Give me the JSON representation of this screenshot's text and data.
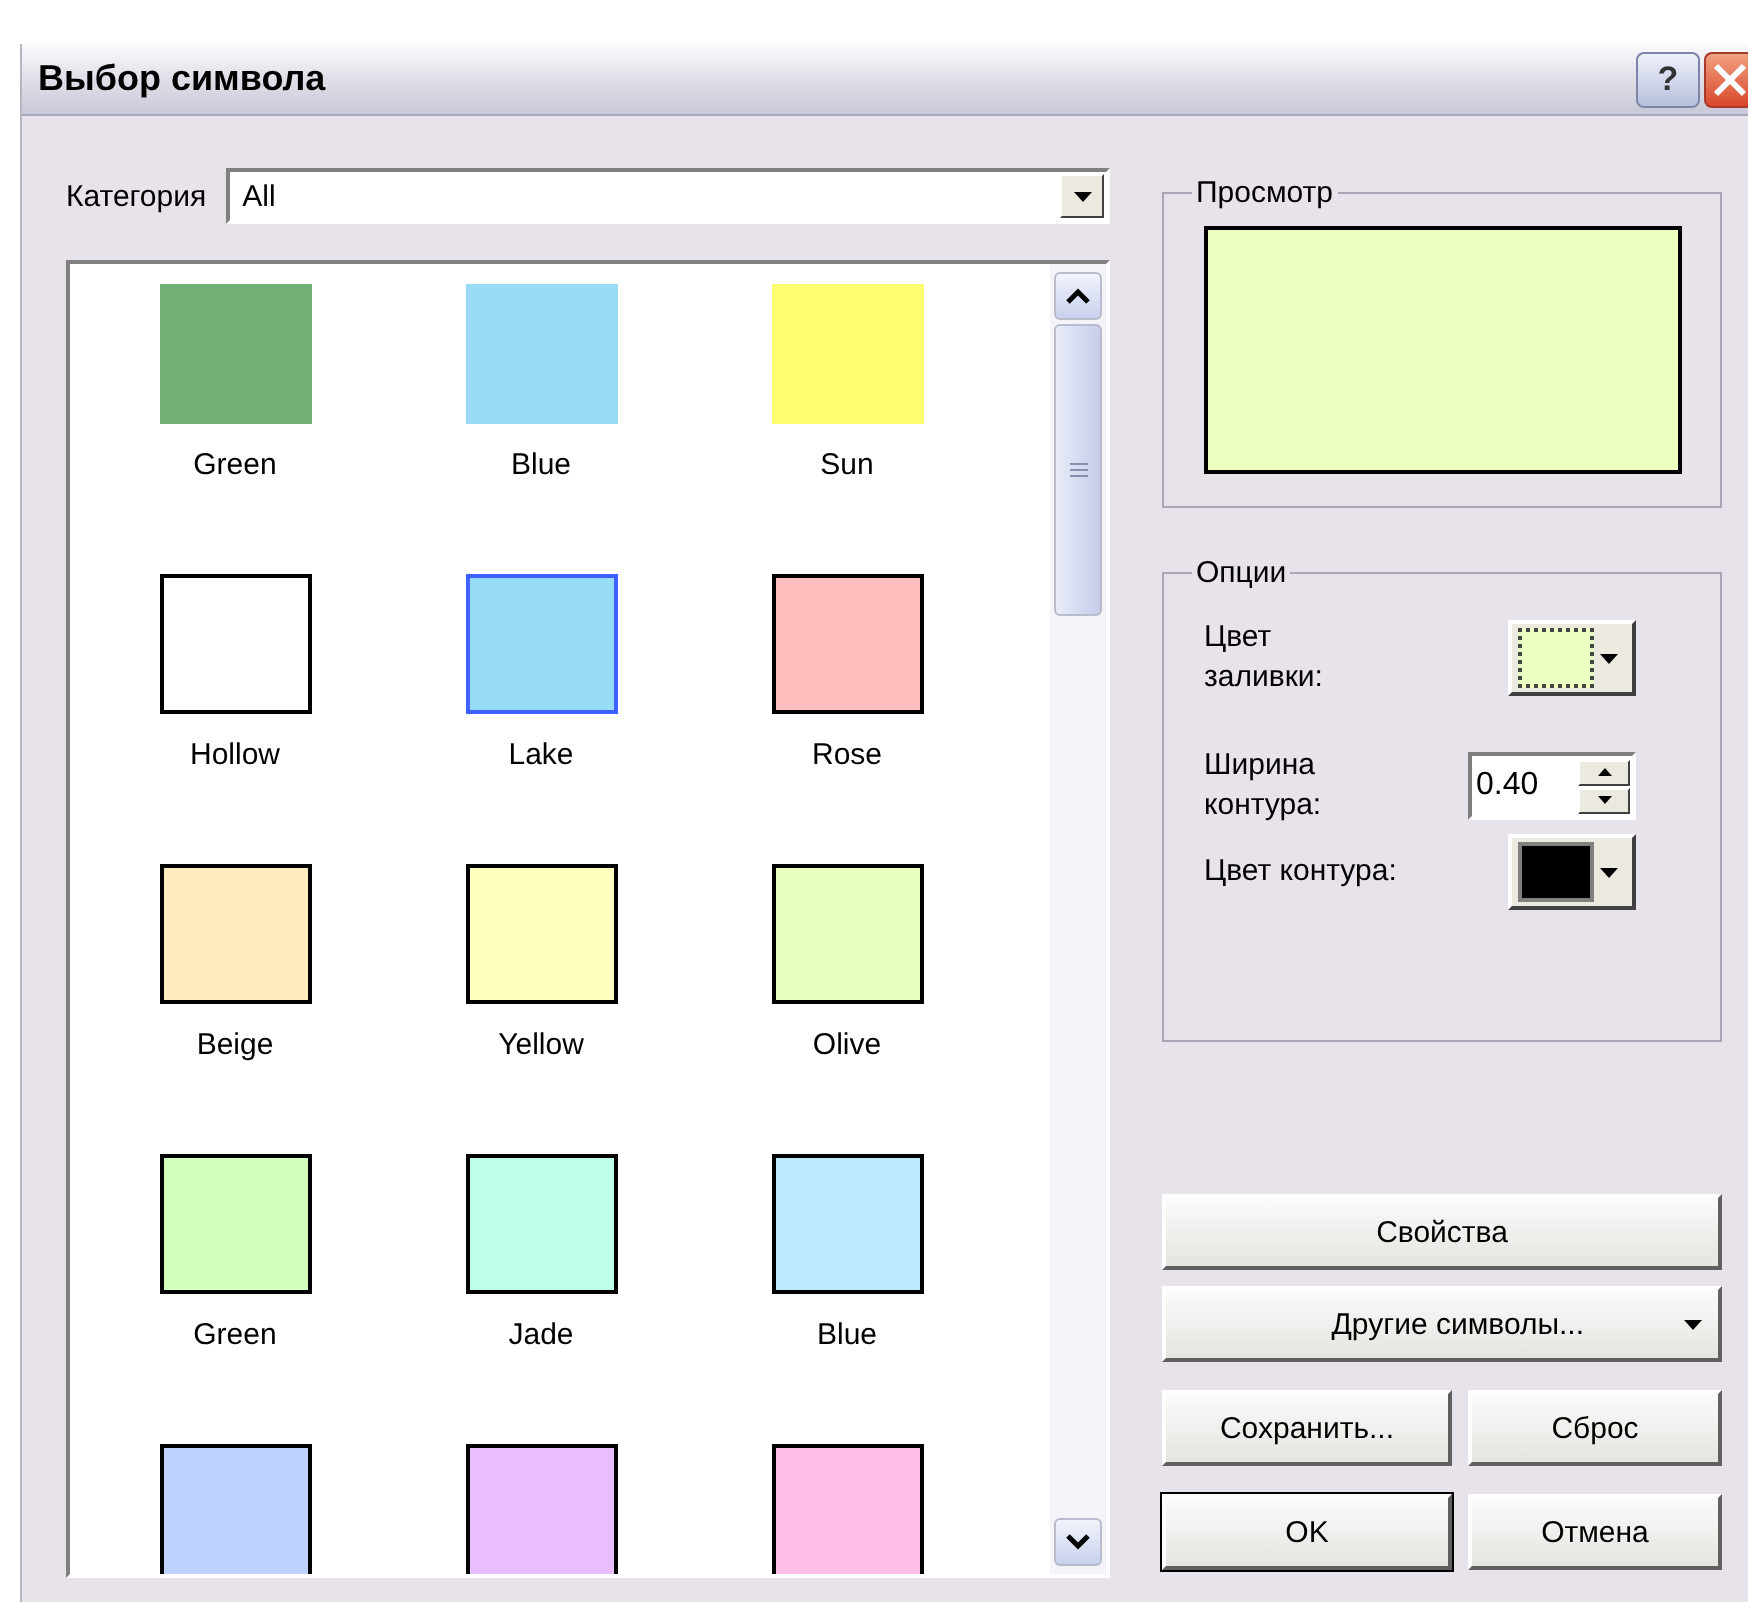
{
  "window": {
    "title": "Выбор символа",
    "help_button": "?"
  },
  "category": {
    "label": "Категория",
    "value": "All"
  },
  "symbols": [
    {
      "label": "Green",
      "color": "#73b073",
      "kind": "solid",
      "selected": false
    },
    {
      "label": "Blue",
      "color": "#97dbf5",
      "kind": "solid",
      "selected": false
    },
    {
      "label": "Sun",
      "color": "#ffff73",
      "kind": "solid",
      "selected": false
    },
    {
      "label": "Hollow",
      "color": "#ffffff",
      "kind": "outlined",
      "selected": false
    },
    {
      "label": "Lake",
      "color": "#97dbf5",
      "kind": "accented",
      "selected": false
    },
    {
      "label": "Rose",
      "color": "#ffbebe",
      "kind": "outlined",
      "selected": false
    },
    {
      "label": "Beige",
      "color": "#ffebbe",
      "kind": "outlined",
      "selected": false
    },
    {
      "label": "Yellow",
      "color": "#ffffbe",
      "kind": "outlined",
      "selected": false
    },
    {
      "label": "Olive",
      "color": "#e9ffbe",
      "kind": "outlined",
      "selected": false
    },
    {
      "label": "Green",
      "color": "#d3ffbe",
      "kind": "outlined",
      "selected": false
    },
    {
      "label": "Jade",
      "color": "#beffe8",
      "kind": "outlined",
      "selected": false
    },
    {
      "label": "Blue",
      "color": "#bee8ff",
      "kind": "outlined",
      "selected": false
    },
    {
      "color": "#bed2ff",
      "kind": "outlined",
      "selected": false
    },
    {
      "color": "#e8beff",
      "kind": "outlined",
      "selected": false
    },
    {
      "color": "#ffbee8",
      "kind": "outlined",
      "selected": false
    }
  ],
  "preview": {
    "title": "Просмотр",
    "color": "#eaffc0"
  },
  "options": {
    "title": "Опции",
    "fill": {
      "label": "Цвет заливки:",
      "color": "#eaffc0"
    },
    "width": {
      "label": "Ширина контура:",
      "value": "0.40"
    },
    "outline": {
      "label": "Цвет контура:",
      "color": "#000000"
    }
  },
  "buttons": {
    "properties": "Свойства",
    "more_symbols": "Другие символы...",
    "save": "Сохранить...",
    "reset": "Сброс",
    "ok": "OK",
    "cancel": "Отмена"
  }
}
